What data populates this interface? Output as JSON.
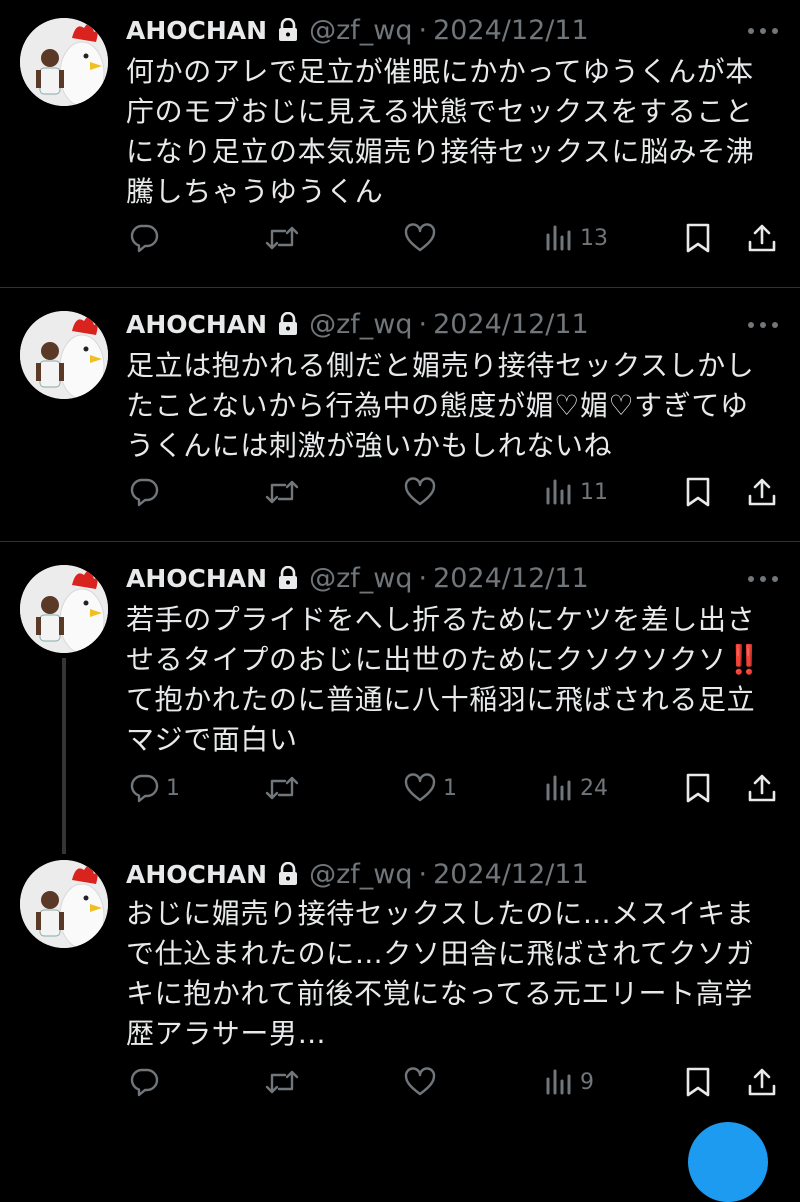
{
  "tweets": [
    {
      "name": "AHOCHAN",
      "handle": "@zf_wq",
      "separator": "·",
      "date": "2024/12/11",
      "lines": [
        "何かのアレで足立が催眠にかかってゆうくんが本",
        "庁のモブおじに見える状態でセックスをすること",
        "になり足立の本気媚売り接待セックスに脳みそ沸",
        "騰しちゃうゆうくん"
      ],
      "replies": "",
      "likes": "",
      "views": "13"
    },
    {
      "name": "AHOCHAN",
      "handle": "@zf_wq",
      "separator": "·",
      "date": "2024/12/11",
      "lines": [
        "足立は抱かれる側だと媚売り接待セックスしかし",
        "たことないから行為中の態度が媚♡媚♡すぎてゆ",
        "うくんには刺激が強いかもしれないね"
      ],
      "replies": "",
      "likes": "",
      "views": "11"
    },
    {
      "name": "AHOCHAN",
      "handle": "@zf_wq",
      "separator": "·",
      "date": "2024/12/11",
      "lines": [
        "若手のプライドをへし折るためにケツを差し出さ",
        "せるタイプのおじに出世のためにクソクソクソ",
        "て抱かれたのに普通に八十稲羽に飛ばされる足立",
        "マジで面白い"
      ],
      "emoji": "‼️",
      "replies": "1",
      "likes": "1",
      "views": "24"
    },
    {
      "name": "AHOCHAN",
      "handle": "@zf_wq",
      "separator": "·",
      "date": "2024/12/11",
      "lines": [
        "おじに媚売り接待セックスしたのに…メスイキま",
        "で仕込まれたのに…クソ田舎に飛ばされてクソガ",
        "キに抱かれて前後不覚になってる元エリート高学",
        "歴アラサー男…"
      ],
      "replies": "",
      "likes": "",
      "views": "9"
    }
  ],
  "icons": {
    "reply": "speech-bubble-icon",
    "retweet": "retweet-arrows-icon",
    "like": "heart-icon",
    "views": "bar-chart-icon",
    "bookmark": "bookmark-icon",
    "share": "share-upload-icon",
    "lock": "lock-icon",
    "more": "more-dots-icon"
  },
  "colors": {
    "background": "#000000",
    "text": "#e7e9ea",
    "secondary": "#71767b",
    "divider": "#2f3336",
    "emoji_red": "#e0245e"
  }
}
